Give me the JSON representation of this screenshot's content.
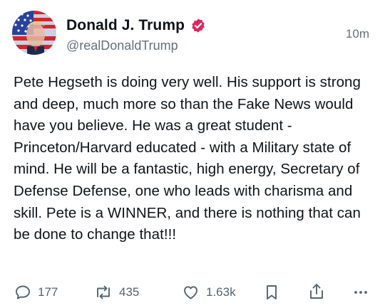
{
  "post": {
    "author_name": "Donald J. Trump",
    "handle": "@realDonaldTrump",
    "time": "10m",
    "verified": true,
    "text": "Pete Hegseth is doing very well. His support is strong and deep, much more so than the Fake News would have you believe. He was a great student - Princeton/Harvard educated - with a Military state of mind. He will be a fantastic, high energy, Secretary of Defense Defense, one who leads with charisma and skill. Pete is a WINNER, and there is nothing that can be done to change that!!!"
  },
  "actions": {
    "replies": "177",
    "reposts": "435",
    "likes": "1.63k"
  },
  "colors": {
    "badge": "#e0245e",
    "muted": "#65707b",
    "text": "#0f1419"
  },
  "icons": [
    "verified-badge-icon",
    "reply-icon",
    "repost-icon",
    "like-icon",
    "bookmark-icon",
    "share-icon",
    "more-icon"
  ]
}
